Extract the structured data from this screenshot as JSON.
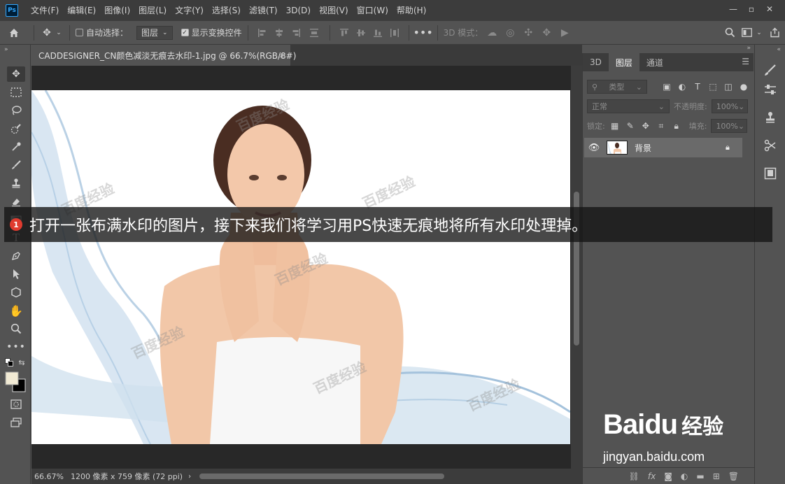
{
  "app": {
    "logo": "Ps"
  },
  "menu": [
    "文件(F)",
    "编辑(E)",
    "图像(I)",
    "图层(L)",
    "文字(Y)",
    "选择(S)",
    "滤镜(T)",
    "3D(D)",
    "视图(V)",
    "窗口(W)",
    "帮助(H)"
  ],
  "window_controls": {
    "minimize": "—",
    "restore": "▫",
    "close": "✕"
  },
  "options": {
    "auto_select_label": "自动选择：",
    "auto_select_value": "图层",
    "show_transform_label": "显示变换控件",
    "mode_3d_label": "3D 模式："
  },
  "document": {
    "tab_title": "CADDESIGNER_CN颜色减淡无痕去水印-1.jpg @ 66.7%(RGB/8#)",
    "close": "×",
    "zoom": "66.67%",
    "size_info": "1200 像素 x 759 像素 (72 ppi)"
  },
  "watermark_text": "百度经验",
  "panel": {
    "tabs": [
      "3D",
      "图层",
      "通道"
    ],
    "active_tab": "图层",
    "filter_label": "类型",
    "blend_mode": "正常",
    "opacity_label": "不透明度:",
    "opacity_value": "100%",
    "lock_label": "锁定:",
    "fill_label": "填充:",
    "fill_value": "100%",
    "layer_name": "背景"
  },
  "caption": {
    "step": "1",
    "text": "打开一张布满水印的图片，接下来我们将学习用PS快速无痕地将所有水印处理掉。"
  },
  "site": {
    "logo_text": "Baidu",
    "logo_cn": "经验",
    "url": "jingyan.baidu.com"
  },
  "colors": {
    "accent": "#31a8ff",
    "badge": "#e03b2f",
    "panel_bg": "#535353",
    "chrome_dark": "#3c3c3c"
  }
}
